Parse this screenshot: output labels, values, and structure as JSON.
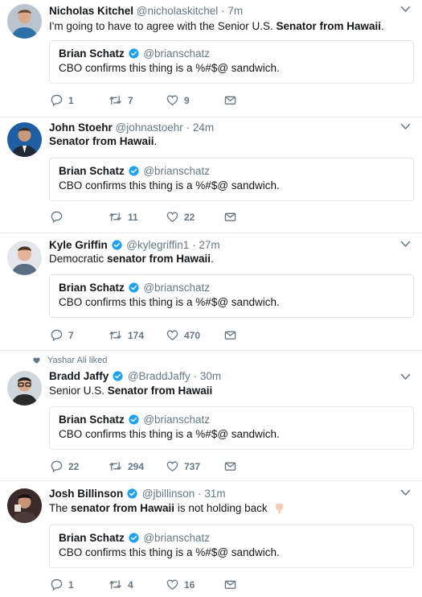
{
  "tweets": [
    {
      "name": "Nicholas Kitchel",
      "handle": "@nicholaskitchel",
      "time": "7m",
      "text_plain_1": "I'm going to have to agree with the Senior U.S. ",
      "text_bold_1": "Senator from Hawaii",
      "text_plain_2": ".",
      "quote_name": "Brian Schatz",
      "quote_handle": "@brianschatz",
      "quote_text": "CBO confirms this thing is a %#$@ sandwich.",
      "replies": "1",
      "retweets": "7",
      "likes": "9"
    },
    {
      "name": "John Stoehr",
      "handle": "@johnastoehr",
      "time": "24m",
      "text_bold_1": "Senator from Hawaii",
      "text_plain_2": ".",
      "quote_name": "Brian Schatz",
      "quote_handle": "@brianschatz",
      "quote_text": "CBO confirms this thing is a %#$@ sandwich.",
      "replies": "",
      "retweets": "11",
      "likes": "22"
    },
    {
      "name": "Kyle Griffin",
      "handle": "@kylegriffin1",
      "time": "27m",
      "text_plain_1": "Democratic ",
      "text_bold_1": "senator from Hawaii",
      "text_plain_2": ".",
      "quote_name": "Brian Schatz",
      "quote_handle": "@brianschatz",
      "quote_text": "CBO confirms this thing is a %#$@ sandwich.",
      "replies": "7",
      "retweets": "174",
      "likes": "470"
    },
    {
      "liked_by": "Yashar Ali liked",
      "name": "Bradd Jaffy",
      "handle": "@BraddJaffy",
      "time": "30m",
      "text_plain_1": "Senior U.S. ",
      "text_bold_1": "Senator from Hawaii",
      "quote_name": "Brian Schatz",
      "quote_handle": "@brianschatz",
      "quote_text": "CBO confirms this thing is a %#$@ sandwich.",
      "replies": "22",
      "retweets": "294",
      "likes": "737"
    },
    {
      "name": "Josh Billinson",
      "handle": "@jbillinson",
      "time": "31m",
      "text_plain_1": "The ",
      "text_bold_1": "senator from Hawaii",
      "text_plain_2": " is not holding back",
      "emoji": "pointing-down-emoji",
      "quote_name": "Brian Schatz",
      "quote_handle": "@brianschatz",
      "quote_text": "CBO confirms this thing is a %#$@ sandwich.",
      "replies": "1",
      "retweets": "4",
      "likes": "16"
    }
  ],
  "sep": "·",
  "colors": {
    "verified": "#1da1f2",
    "muted": "#657786",
    "border": "#e1e8ed"
  },
  "icons": [
    "reply-icon",
    "retweet-icon",
    "like-icon",
    "direct-message-icon",
    "verified-badge-icon",
    "chevron-down-icon",
    "heart-icon"
  ]
}
